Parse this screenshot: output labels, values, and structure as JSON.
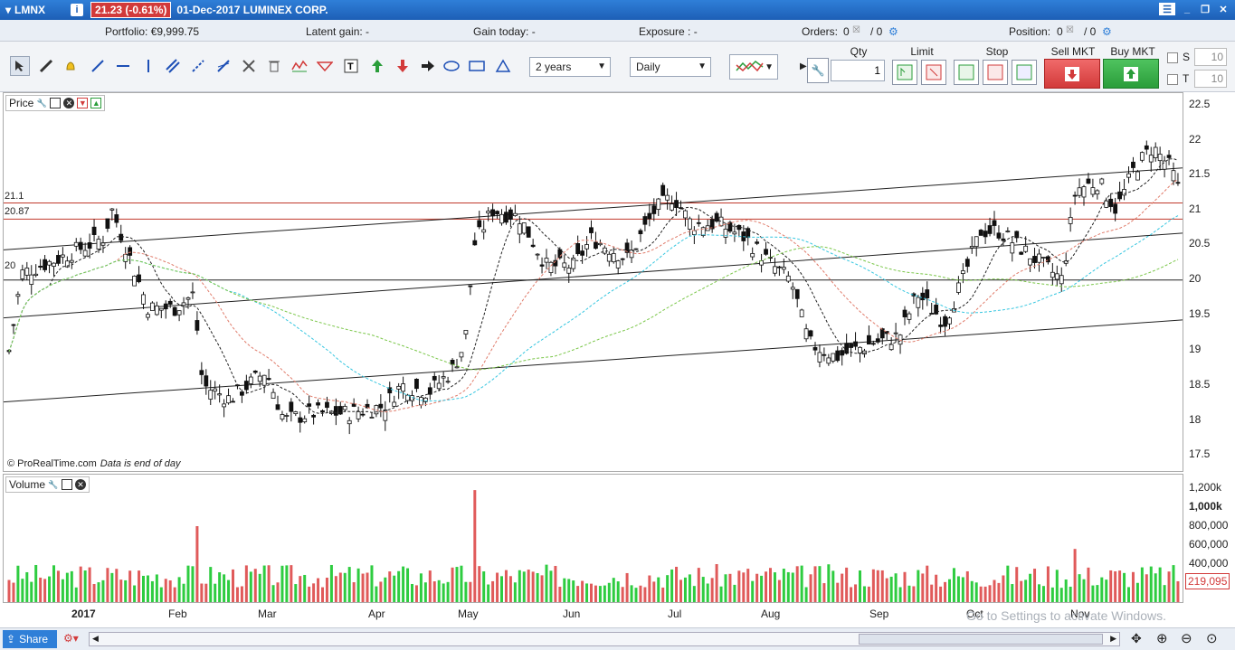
{
  "titlebar": {
    "symbol": "LMNX",
    "price": "21.23 (-0.61%)",
    "date_name": "01-Dec-2017 LUMINEX CORP."
  },
  "infobar": {
    "portfolio": "Portfolio: €9,999.75",
    "latent_gain": "Latent gain: -",
    "gain_today": "Gain today: -",
    "exposure": "Exposure : -",
    "orders_label": "Orders:",
    "orders_a": "0",
    "orders_b": "/ 0",
    "position_label": "Position:",
    "position_a": "0",
    "position_b": "/ 0"
  },
  "toolbar": {
    "period": "2 years",
    "interval": "Daily"
  },
  "order": {
    "qty_label": "Qty",
    "qty_value": "1",
    "limit_label": "Limit",
    "stop_label": "Stop",
    "sell_label": "Sell MKT",
    "buy_label": "Buy MKT",
    "s_label": "S",
    "t_label": "T",
    "s_value": "10",
    "t_value": "10"
  },
  "price_panel": {
    "title": "Price",
    "level_211": "21.1",
    "level_2087": "20.87",
    "level_20": "20",
    "copyright": "© ProRealTime.com",
    "eod": "Data is end of day",
    "yticks": [
      "22.5",
      "22",
      "21.5",
      "21",
      "20.5",
      "20",
      "19.5",
      "19",
      "18.5",
      "18",
      "17.5"
    ]
  },
  "volume_panel": {
    "title": "Volume",
    "yticks": [
      "1,200k",
      "1,000k",
      "800,000",
      "600,000",
      "400,000"
    ],
    "last_volume": "219,095"
  },
  "xaxis": {
    "labels": [
      "2017",
      "Feb",
      "Mar",
      "Apr",
      "May",
      "Jun",
      "Jul",
      "Aug",
      "Sep",
      "Oct",
      "Nov"
    ]
  },
  "statusbar": {
    "share": "Share"
  },
  "watermark": "Go to Settings to activate Windows.",
  "colors": {
    "titlebar": "#1d5fb6",
    "up": "#2ecc40",
    "down": "#e05a5a",
    "sell": "#e84a4a",
    "buy": "#37b24d"
  }
}
